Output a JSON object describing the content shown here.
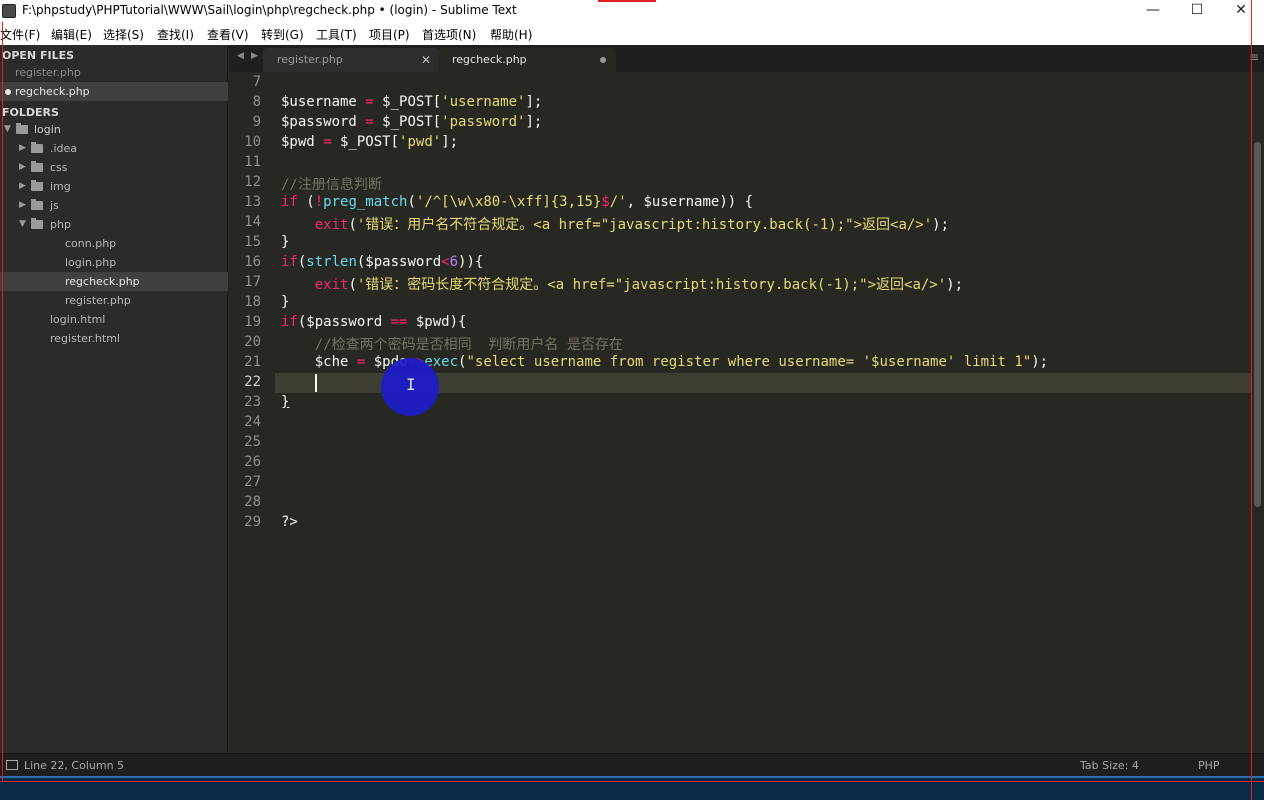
{
  "window": {
    "title": "F:\\phpstudy\\PHPTutorial\\WWW\\Sail\\login\\php\\regcheck.php • (login) - Sublime Text",
    "minimize_glyph": "—",
    "maximize_glyph": "☐",
    "close_glyph": "✕"
  },
  "menu": [
    "文件(F)",
    "编辑(E)",
    "选择(S)",
    "查找(I)",
    "查看(V)",
    "转到(G)",
    "工具(T)",
    "项目(P)",
    "首选项(N)",
    "帮助(H)"
  ],
  "sidebar": {
    "open_files_heading": "OPEN FILES",
    "open_files": [
      "register.php",
      "regcheck.php"
    ],
    "folders_heading": "FOLDERS",
    "tree": {
      "root": "login",
      "folders": [
        ".idea",
        "css",
        "img",
        "js",
        "php"
      ],
      "php_files": [
        "conn.php",
        "login.php",
        "regcheck.php",
        "register.php"
      ],
      "root_files": [
        "login.html",
        "register.html"
      ]
    }
  },
  "tabs": [
    {
      "label": "register.php",
      "active": false
    },
    {
      "label": "regcheck.php",
      "active": true,
      "modified": true
    }
  ],
  "editor": {
    "line_numbers": [
      "7",
      "8",
      "9",
      "10",
      "11",
      "12",
      "13",
      "14",
      "15",
      "16",
      "17",
      "18",
      "19",
      "20",
      "21",
      "22",
      "23",
      "24",
      "25",
      "26",
      "27",
      "28",
      "29"
    ],
    "current_line": "22",
    "code": {
      "l8_var": "$username",
      "l8_rest": "$_POST[",
      "l8_str": "'username'",
      "l8_end": "];",
      "l9_var": "$password",
      "l9_rest": "$_POST[",
      "l9_str": "'password'",
      "l9_end": "];",
      "l10_var": "$pwd",
      "l10_rest": "$_POST[",
      "l10_str": "'pwd'",
      "l10_end": "];",
      "eq": " = ",
      "l12_comment": "//注册信息判断",
      "l13_if": "if",
      "l13_a": " (",
      "l13_not": "!",
      "l13_fn": "preg_match",
      "l13_b": "(",
      "l13_s1": "'/^[\\w\\x80-\\xff]{3,15}",
      "l13_dollar": "$",
      "l13_s2": "/'",
      "l13_c": ", $username)) {",
      "l14_indent": "    ",
      "l14_fn": "exit",
      "l14_a": "(",
      "l14_str": "'错误：用户名不符合规定。<a href=\"javascript:history.back(-1);\">返回<a/>'",
      "l14_end": ");",
      "l15": "}",
      "l16_if": "if",
      "l16_a": "(",
      "l16_fn": "strlen",
      "l16_b": "($password",
      "l16_lt": "<",
      "l16_num": "6",
      "l16_c": ")){",
      "l17_indent": "    ",
      "l17_fn": "exit",
      "l17_a": "(",
      "l17_str": "'错误：密码长度不符合规定。<a href=\"javascript:history.back(-1);\">返回<a/>'",
      "l17_end": ");",
      "l18": "}",
      "l19_if": "if",
      "l19_a": "($password ",
      "l19_eq": "==",
      "l19_b": " $pwd){",
      "l20_indent": "    ",
      "l20_comment": "//检查两个密码是否相同  判断用户名 是否存在",
      "l21_indent": "    ",
      "l21_a": "$che",
      "l21_b": "$pdo",
      "l21_arrow": "->",
      "l21_fn": "exec",
      "l21_c": "(",
      "l21_str": "\"select username from register where username= '$username' limit 1\"",
      "l21_end": ");",
      "l23": "}",
      "l29": "?>"
    }
  },
  "statusbar": {
    "position": "Line 22, Column 5",
    "tab_size": "Tab Size: 4",
    "syntax": "PHP"
  }
}
